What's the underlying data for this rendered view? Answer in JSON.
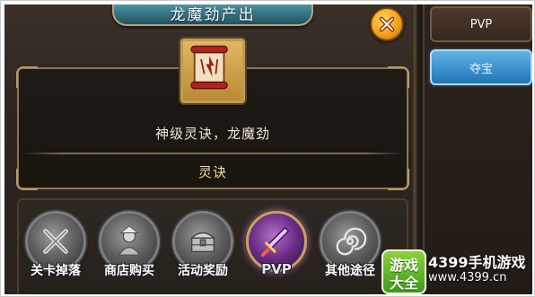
{
  "header": {
    "title": "龙魔劲产出"
  },
  "item": {
    "description": "神级灵诀，龙魔劲",
    "category": "灵诀"
  },
  "sources": [
    {
      "label": "关卡掉落",
      "icon": "crossed-swords-icon",
      "active": false
    },
    {
      "label": "商店购买",
      "icon": "merchant-icon",
      "active": false
    },
    {
      "label": "活动奖励",
      "icon": "treasure-chest-icon",
      "active": false
    },
    {
      "label": "PVP",
      "icon": "sword-icon",
      "active": true
    },
    {
      "label": "其他途径",
      "icon": "spiral-icon",
      "active": false
    }
  ],
  "side_tabs": [
    {
      "label": "PVP",
      "selected": false
    },
    {
      "label": "夺宝",
      "selected": true
    }
  ],
  "watermark": {
    "badge_line1": "游戏",
    "badge_line2": "大全",
    "name": "4399手机游戏",
    "url": "www.4399.cn"
  },
  "colors": {
    "accent_gold": "#f3dc95",
    "selected_tab": "#1f75b8",
    "close_button": "#f2a21b"
  }
}
